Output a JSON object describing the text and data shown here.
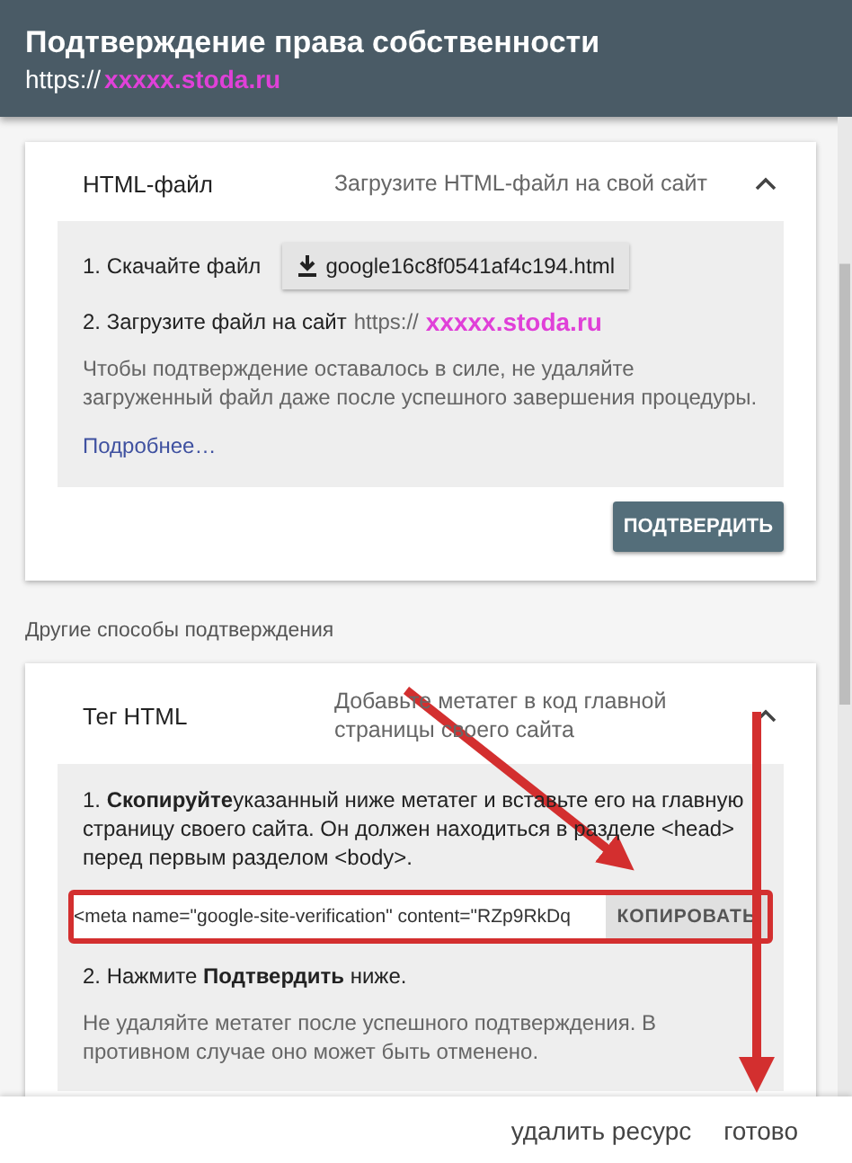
{
  "header": {
    "title": "Подтверждение права собственности",
    "url_prefix": "https://",
    "url_domain": "xxxxx.stoda.ru"
  },
  "primary_method": {
    "title": "HTML-файл",
    "description": "Загрузите HTML-файл на свой сайт",
    "expanded": true,
    "step1_label": "1. Скачайте файл",
    "download_file": "google16c8f0541af4c194.html",
    "step2_label": "2. Загрузите файл на сайт",
    "step2_prefix": "https://",
    "step2_domain": "xxxxx.stoda.ru",
    "note": "Чтобы подтверждение оставалось в силе, не удаляйте загруженный файл даже после успешного завершения процедуры.",
    "more_link": "Подробнее…",
    "confirm_button": "ПОДТВЕРДИТЬ"
  },
  "other_methods_heading": "Другие способы подтверждения",
  "other_method": {
    "title": "Тег HTML",
    "description": "Добавьте метатег в код главной страницы своего сайта",
    "expanded": true,
    "step1": "1. **Скопируйте**указанный ниже метатег и вставьте его на главную страницу своего сайта. Он должен находиться в разделе <head> перед первым разделом <body>.",
    "meta_tag": "<meta name=\"google-site-verification\" content=\"RZp9RkDq",
    "copy_button": "КОПИРОВАТЬ",
    "step2": "2. Нажмите **Подтвердить** ниже.",
    "note": "Не удаляйте метатег после успешного подтверждения. В противном случае оно может быть отменено."
  },
  "footer": {
    "remove_button": "удалить ресурс",
    "done_button": "готово"
  }
}
